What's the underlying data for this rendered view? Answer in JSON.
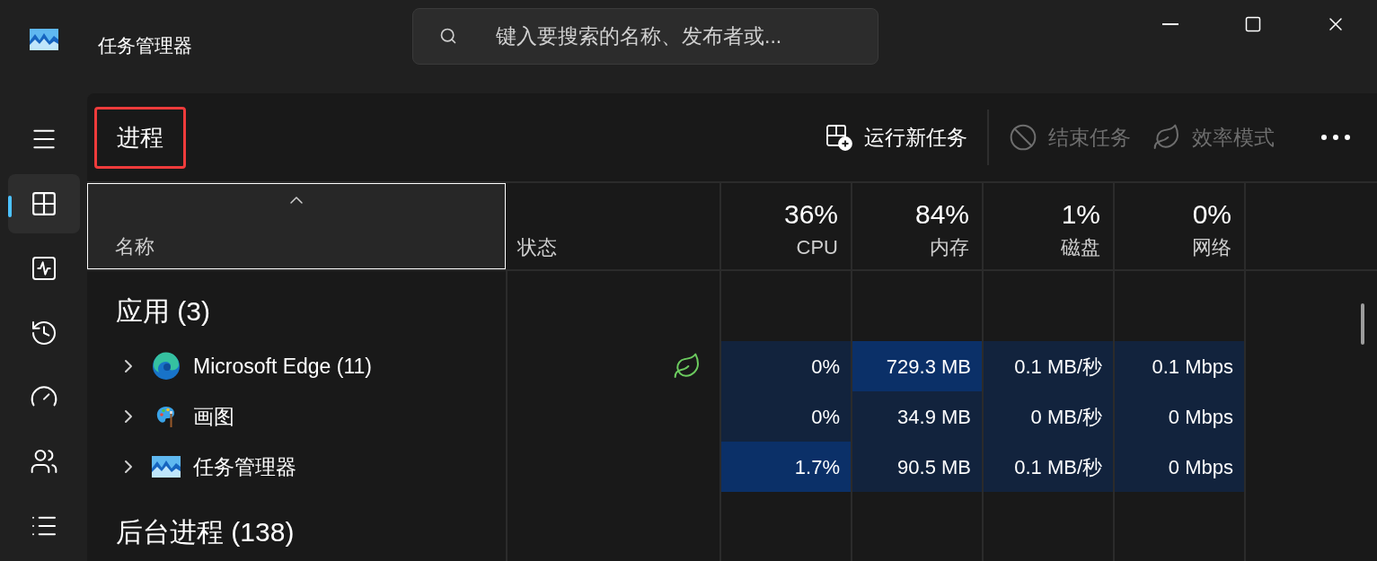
{
  "window": {
    "title": "任务管理器"
  },
  "search": {
    "placeholder": "键入要搜索的名称、发布者或..."
  },
  "rail": [
    {
      "selected": false
    },
    {
      "selected": true
    },
    {
      "selected": false
    },
    {
      "selected": false
    },
    {
      "selected": false
    },
    {
      "selected": false
    },
    {
      "selected": false
    }
  ],
  "page": {
    "title": "进程",
    "highlighted": true
  },
  "toolbar": [
    {
      "label": "运行新任务",
      "disabled": false
    },
    {
      "label": "结束任务",
      "disabled": true
    },
    {
      "label": "效率模式",
      "disabled": true
    }
  ],
  "columns": [
    {
      "label": "名称",
      "sorted": true,
      "focused": true
    },
    {
      "label": "状态",
      "sorted": false,
      "focused": false
    },
    {
      "label": "CPU",
      "summary": "36%",
      "sorted": false,
      "focused": false
    },
    {
      "label": "内存",
      "summary": "84%",
      "sorted": false,
      "focused": false
    },
    {
      "label": "磁盘",
      "summary": "1%",
      "sorted": false,
      "focused": false
    },
    {
      "label": "网络",
      "summary": "0%",
      "sorted": false,
      "focused": false
    }
  ],
  "groups": [
    {
      "title": "应用 (3)",
      "rows": [
        {
          "name": "Microsoft Edge (11)",
          "kind": "edge",
          "efficiency": true,
          "cells": [
            {
              "value": "0%",
              "hot": false
            },
            {
              "value": "729.3 MB",
              "hot": true
            },
            {
              "value": "0.1 MB/秒",
              "hot": false
            },
            {
              "value": "0.1 Mbps",
              "hot": false
            }
          ]
        },
        {
          "name": "画图",
          "kind": "paint",
          "efficiency": false,
          "cells": [
            {
              "value": "0%",
              "hot": false
            },
            {
              "value": "34.9 MB",
              "hot": false
            },
            {
              "value": "0 MB/秒",
              "hot": false
            },
            {
              "value": "0 Mbps",
              "hot": false
            }
          ]
        },
        {
          "name": "任务管理器",
          "kind": "taskmgr",
          "efficiency": false,
          "cells": [
            {
              "value": "1.7%",
              "hot": true
            },
            {
              "value": "90.5 MB",
              "hot": false
            },
            {
              "value": "0.1 MB/秒",
              "hot": false
            },
            {
              "value": "0 Mbps",
              "hot": false
            }
          ]
        }
      ]
    },
    {
      "title": "后台进程 (138)"
    }
  ]
}
